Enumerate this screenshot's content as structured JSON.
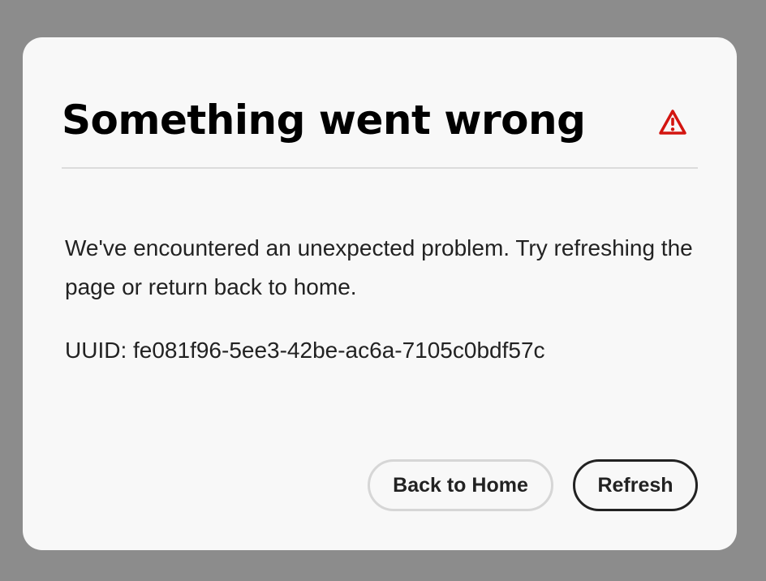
{
  "dialog": {
    "title": "Something went wrong",
    "icon": "alert-icon",
    "accent_color": "#d31510",
    "message": "We've encountered an unexpected problem. Try refreshing the page or return back to home.",
    "uuid_text": "UUID: fe081f96-5ee3-42be-ac6a-7105c0bdf57c",
    "buttons": {
      "back_home_label": "Back to Home",
      "refresh_label": "Refresh"
    }
  }
}
